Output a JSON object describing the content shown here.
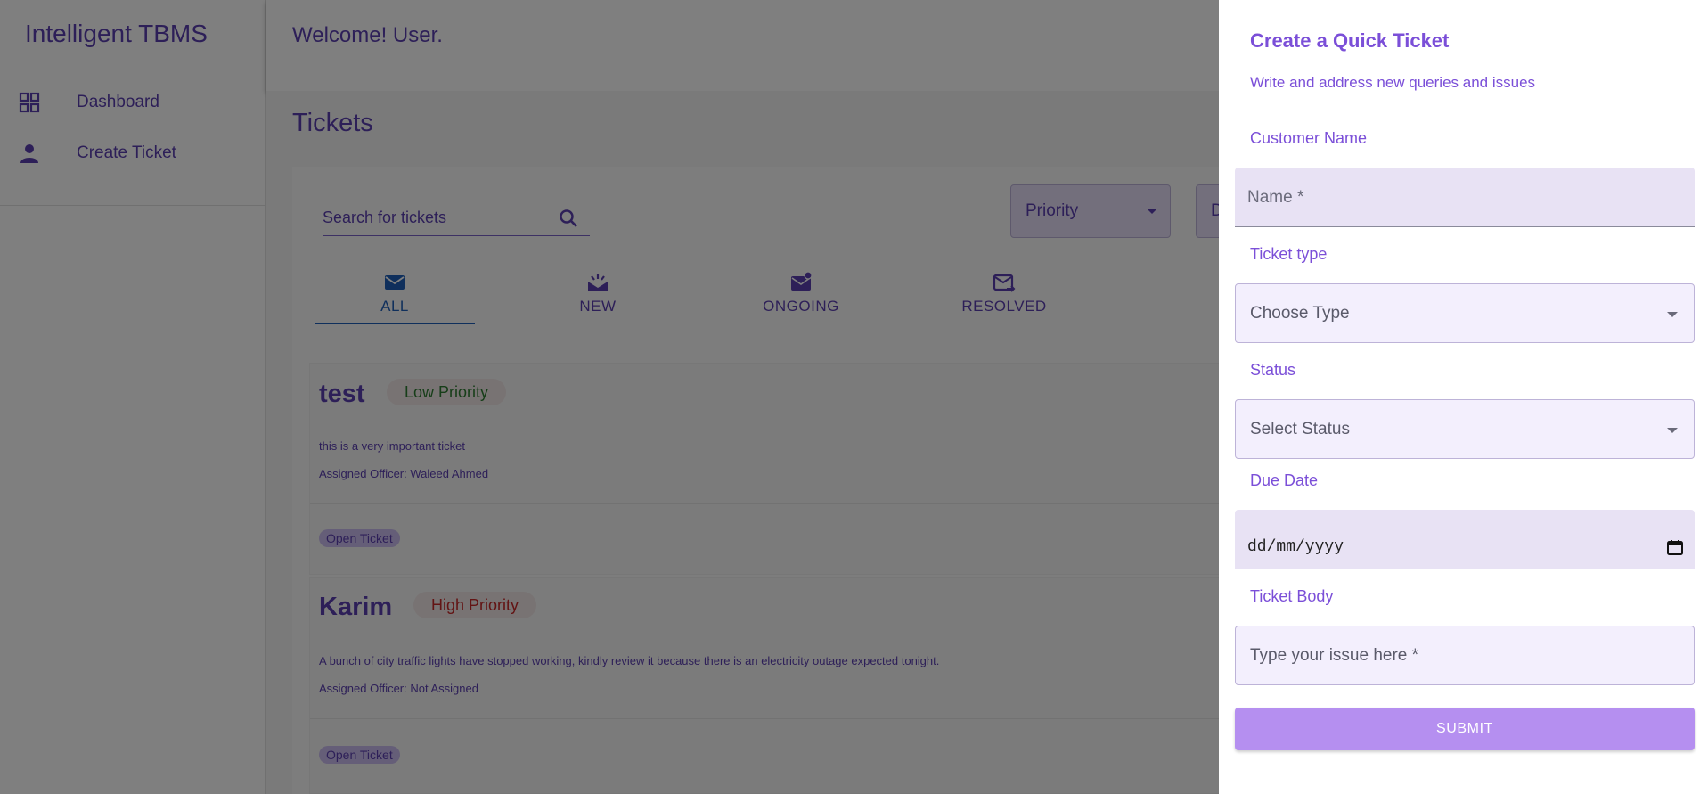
{
  "app": {
    "title": "Intelligent TBMS"
  },
  "sidebar": {
    "items": [
      {
        "label": "Dashboard",
        "icon": "grid-icon"
      },
      {
        "label": "Create Ticket",
        "icon": "person-icon"
      }
    ]
  },
  "header": {
    "welcome": "Welcome! User."
  },
  "main": {
    "title": "Tickets",
    "search": {
      "placeholder": "Search for tickets"
    },
    "filters": [
      {
        "label": "Priority"
      },
      {
        "label": "D"
      }
    ],
    "tabs": [
      {
        "label": "ALL",
        "icon": "mail-icon",
        "active": true
      },
      {
        "label": "NEW",
        "icon": "mail-open-icon",
        "active": false
      },
      {
        "label": "ONGOING",
        "icon": "mail-badge-icon",
        "active": false
      },
      {
        "label": "RESOLVED",
        "icon": "mail-forward-icon",
        "active": false
      }
    ],
    "tickets": [
      {
        "title": "test",
        "priority": "Low Priority",
        "priority_color": "#2e7d32",
        "description": "this is a very important ticket",
        "officer": "Assigned Officer: Waleed Ahmed",
        "status": "Open Ticket"
      },
      {
        "title": "Karim",
        "priority": "High Priority",
        "priority_color": "#c62828",
        "description": "A bunch of city traffic lights have stopped working, kindly review it because there is an electricity outage expected tonight.",
        "officer": "Assigned Officer: Not Assigned",
        "status": "Open Ticket"
      }
    ]
  },
  "modal": {
    "title": "Create a Quick Ticket",
    "subtitle": "Write and address new queries and issues",
    "customer_label": "Customer Name",
    "name_placeholder": "Name *",
    "type_label": "Ticket type",
    "type_value": "Choose Type",
    "status_label": "Status",
    "status_value": "Select Status",
    "due_label": "Due Date",
    "due_value": "dd/mm/yyyy",
    "body_label": "Ticket Body",
    "body_placeholder": "Type your issue here *",
    "submit_label": "SUBMIT"
  },
  "colors": {
    "accent": "#5b3fb0",
    "modal_accent": "#7b4fd8",
    "submit": "#b58ff0",
    "tab_active": "#1e5fb8"
  }
}
